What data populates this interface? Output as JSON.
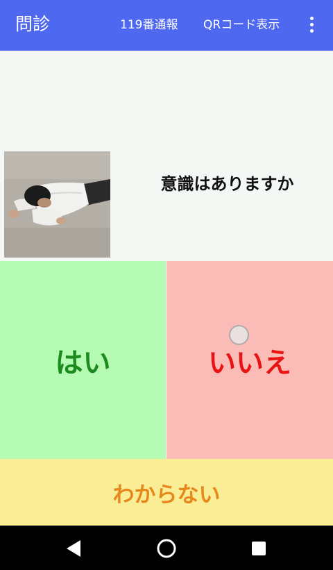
{
  "appbar": {
    "title": "問診",
    "actions": {
      "emergency_call": "119番通報",
      "show_qr": "QRコード表示"
    },
    "overflow_icon": "more-vert-icon",
    "background_color": "#4f68f0"
  },
  "question": {
    "text": "意識はありますか",
    "image": "person-lying-face-down-photo"
  },
  "answers": {
    "yes": "はい",
    "no": "いいえ",
    "unknown": "わからない"
  },
  "colors": {
    "yes_bg": "#b5fbb3",
    "yes_text": "#1c8a1c",
    "no_bg": "#fbbcb7",
    "no_text": "#e81414",
    "unknown_bg": "#f9ed96",
    "unknown_text": "#e8881a"
  },
  "navbar": {
    "back_icon": "back-triangle-icon",
    "home_icon": "home-circle-icon",
    "recents_icon": "recents-square-icon"
  }
}
